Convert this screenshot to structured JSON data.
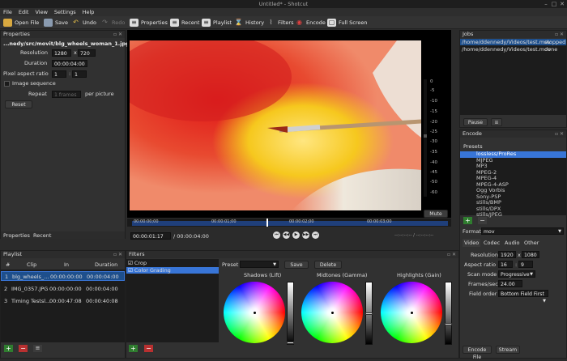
{
  "window": {
    "title": "Untitled* - Shotcut"
  },
  "menu": [
    "File",
    "Edit",
    "View",
    "Settings",
    "Help"
  ],
  "toolbar": {
    "open": "Open File",
    "save": "Save",
    "undo": "Undo",
    "redo": "Redo",
    "properties": "Properties",
    "recent": "Recent",
    "playlist": "Playlist",
    "history": "History",
    "filters": "Filters",
    "encode": "Encode",
    "fullscreen": "Full Screen"
  },
  "properties": {
    "title": "Properties",
    "path": "...nedy/src/movit/blg_wheels_woman_1.jpg",
    "resolution_label": "Resolution",
    "res_w": "1280",
    "res_x": "x",
    "res_h": "720",
    "duration_label": "Duration",
    "duration": "00:00:04:00",
    "par_label": "Pixel aspect ratio",
    "par_a": "1",
    "par_sep": ":",
    "par_b": "1",
    "seq_label": "Image sequence",
    "repeat_label": "Repeat",
    "repeat_value": "1 frames",
    "per_picture": "per picture",
    "reset": "Reset"
  },
  "left_tabs": [
    "Properties",
    "Recent"
  ],
  "playlist": {
    "title": "Playlist",
    "headers": [
      "#",
      "Clip",
      "In",
      "Duration"
    ],
    "rows": [
      {
        "n": "1",
        "clip": "blg_wheels_...",
        "in": "00:00:00:00",
        "dur": "00:00:04:00"
      },
      {
        "n": "2",
        "clip": "IMG_0357.JPG",
        "in": "00:00:00:00",
        "dur": "00:00:04:00"
      },
      {
        "n": "3",
        "clip": "Timing Testsl...",
        "in": "00:00:47:08",
        "dur": "00:00:40:08"
      }
    ]
  },
  "meter": {
    "ticks": [
      "0",
      "-5",
      "-10",
      "-15",
      "-20",
      "-25",
      "-30",
      "-35",
      "-40",
      "-45",
      "-50",
      "-60"
    ],
    "mute": "Mute"
  },
  "timeline": {
    "labels": [
      "00:00:00;00",
      "00:00:01;00",
      "00:00:02;00",
      "00:00:03;00"
    ],
    "position": "00:00:01:17",
    "duration": "/ 00:00:04:00",
    "inout": "--:--:--:-- / --:--:--:--"
  },
  "filters": {
    "title": "Filters",
    "items": [
      {
        "label": "Crop",
        "checked": true
      },
      {
        "label": "Color Grading",
        "checked": true
      }
    ],
    "preset_label": "Preset",
    "save": "Save",
    "delete": "Delete",
    "wheels": [
      "Shadows (Lift)",
      "Midtones (Gamma)",
      "Highlights (Gain)"
    ]
  },
  "jobs": {
    "title": "Jobs",
    "rows": [
      {
        "path": "/home/ddennedy/Videos/test.mov",
        "status": "stopped"
      },
      {
        "path": "/home/ddennedy/Videos/test.mov",
        "status": "done"
      }
    ],
    "pause": "Pause"
  },
  "encode": {
    "title": "Encode",
    "presets_label": "Presets",
    "presets": [
      "lossless/ProRes",
      "MJPEG",
      "MP3",
      "MPEG-2",
      "MPEG-4",
      "MPEG-4-ASP",
      "Ogg Vorbis",
      "Sony-PSP",
      "stills/BMP",
      "stills/DPX",
      "stills/JPEG"
    ],
    "format_label": "Format",
    "format": "mov",
    "tabs": [
      "Video",
      "Codec",
      "Audio",
      "Other"
    ],
    "resolution_label": "Resolution",
    "res_w": "1920",
    "res_x": "x",
    "res_h": "1080",
    "aspect_label": "Aspect ratio",
    "asp_w": "16",
    "asp_sep": ":",
    "asp_h": "9",
    "scan_label": "Scan mode",
    "scan": "Progressive",
    "fps_label": "Frames/sec",
    "fps": "24.00",
    "field_label": "Field order",
    "field": "Bottom Field First",
    "encode_file": "Encode File",
    "stream": "Stream"
  }
}
